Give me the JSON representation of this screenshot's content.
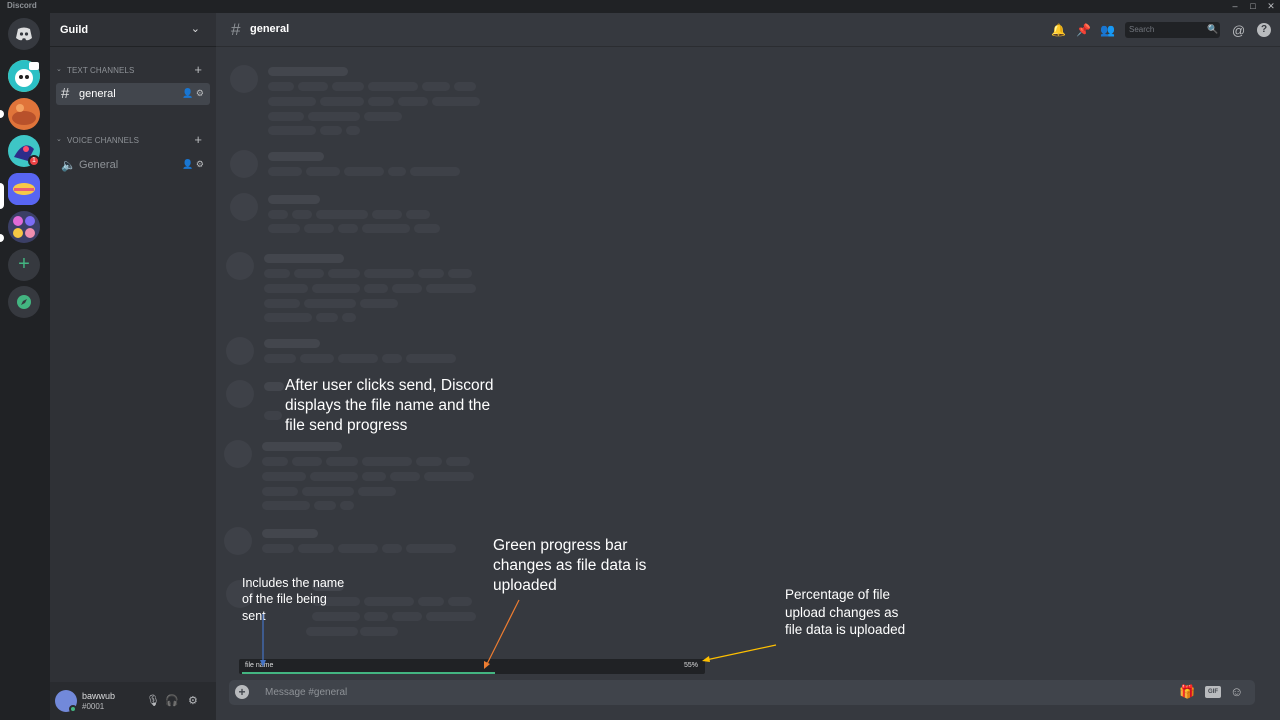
{
  "app": {
    "title": "Discord"
  },
  "window_controls": {
    "minimize": "–",
    "maximize": "□",
    "close": "✕"
  },
  "guild": {
    "name": "Guild"
  },
  "categories": [
    {
      "label": "TEXT CHANNELS"
    },
    {
      "label": "VOICE CHANNELS"
    }
  ],
  "channels": {
    "text": [
      {
        "label": "general",
        "active": true
      }
    ],
    "voice": [
      {
        "label": "General"
      }
    ]
  },
  "guild_list": {
    "badges": [
      "1"
    ]
  },
  "header": {
    "channel": "general",
    "search_placeholder": "Search"
  },
  "user": {
    "name": "bawwub",
    "discriminator": "#0001"
  },
  "upload": {
    "file_name": "file name",
    "percent_label": "55%",
    "progress": 0.55
  },
  "composer": {
    "placeholder": "Message #general"
  },
  "annotations": {
    "main": "After user clicks send, Discord displays the file name and the file send progress",
    "progress": "Green progress bar changes as file data is uploaded",
    "name": "Includes the name of the file being sent",
    "percent": "Percentage of file upload changes as file data is uploaded"
  },
  "colors": {
    "progress": "#43b581",
    "arrow_orange": "#ed7d31",
    "arrow_yellow": "#ffc000",
    "arrow_blue": "#4472c4"
  },
  "icons": {
    "bell": "bell-icon",
    "pin": "pin-icon",
    "members": "members-icon",
    "mention": "at-icon",
    "help": "help-icon",
    "gift": "gift-icon",
    "emoji": "emoji-icon"
  }
}
